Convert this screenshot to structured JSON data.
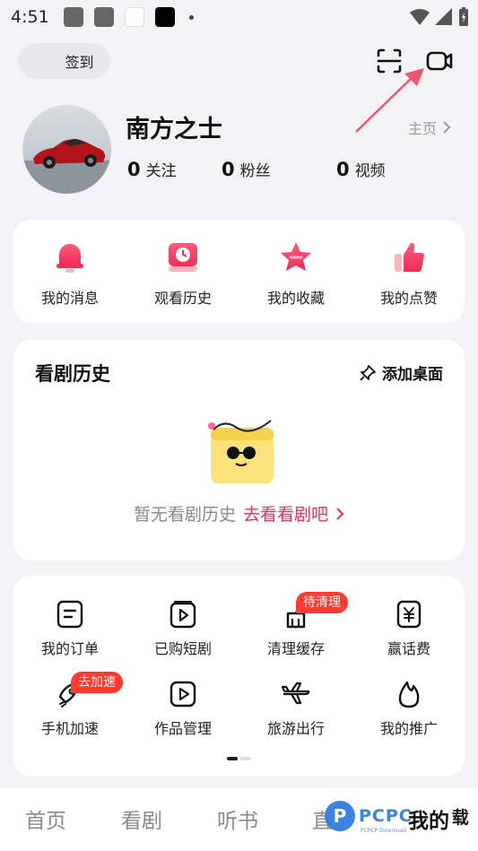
{
  "status_bar": {
    "time": "4:51"
  },
  "header": {
    "signin_label": "签到",
    "scan_icon": "scan-icon",
    "video_icon": "video-camera-icon"
  },
  "profile": {
    "name": "南方之士",
    "homepage_label": "主页",
    "stats": [
      {
        "num": "0",
        "label": "关注"
      },
      {
        "num": "0",
        "label": "粉丝"
      },
      {
        "num": "0",
        "label": "视频"
      }
    ]
  },
  "quick_actions": [
    {
      "label": "我的消息",
      "icon": "bell-icon"
    },
    {
      "label": "观看历史",
      "icon": "clock-icon"
    },
    {
      "label": "我的收藏",
      "icon": "star-icon"
    },
    {
      "label": "我的点赞",
      "icon": "thumbs-up-icon"
    }
  ],
  "history": {
    "title": "看剧历史",
    "add_desktop_label": "添加桌面",
    "empty_text": "暂无看剧历史",
    "empty_link": "去看看剧吧"
  },
  "tools": {
    "items": [
      {
        "label": "我的订单",
        "icon": "order-icon"
      },
      {
        "label": "已购短剧",
        "icon": "purchased-play-icon"
      },
      {
        "label": "清理缓存",
        "icon": "broom-icon",
        "badge": "待清理"
      },
      {
        "label": "赢话费",
        "icon": "yuan-icon"
      },
      {
        "label": "手机加速",
        "icon": "rocket-icon",
        "badge": "去加速"
      },
      {
        "label": "作品管理",
        "icon": "works-play-icon"
      },
      {
        "label": "旅游出行",
        "icon": "airplane-icon"
      },
      {
        "label": "我的推广",
        "icon": "flame-icon"
      }
    ]
  },
  "tabbar": {
    "tabs": [
      "首页",
      "看剧",
      "听书",
      "直",
      "我的"
    ],
    "active": "我的"
  },
  "watermark": {
    "text": "PCPC",
    "sub": "PCPCP Download",
    "tail": "载"
  },
  "colors": {
    "accent": "#ee2d59",
    "badge": "#ff3b30",
    "background": "#f3f3f5"
  }
}
